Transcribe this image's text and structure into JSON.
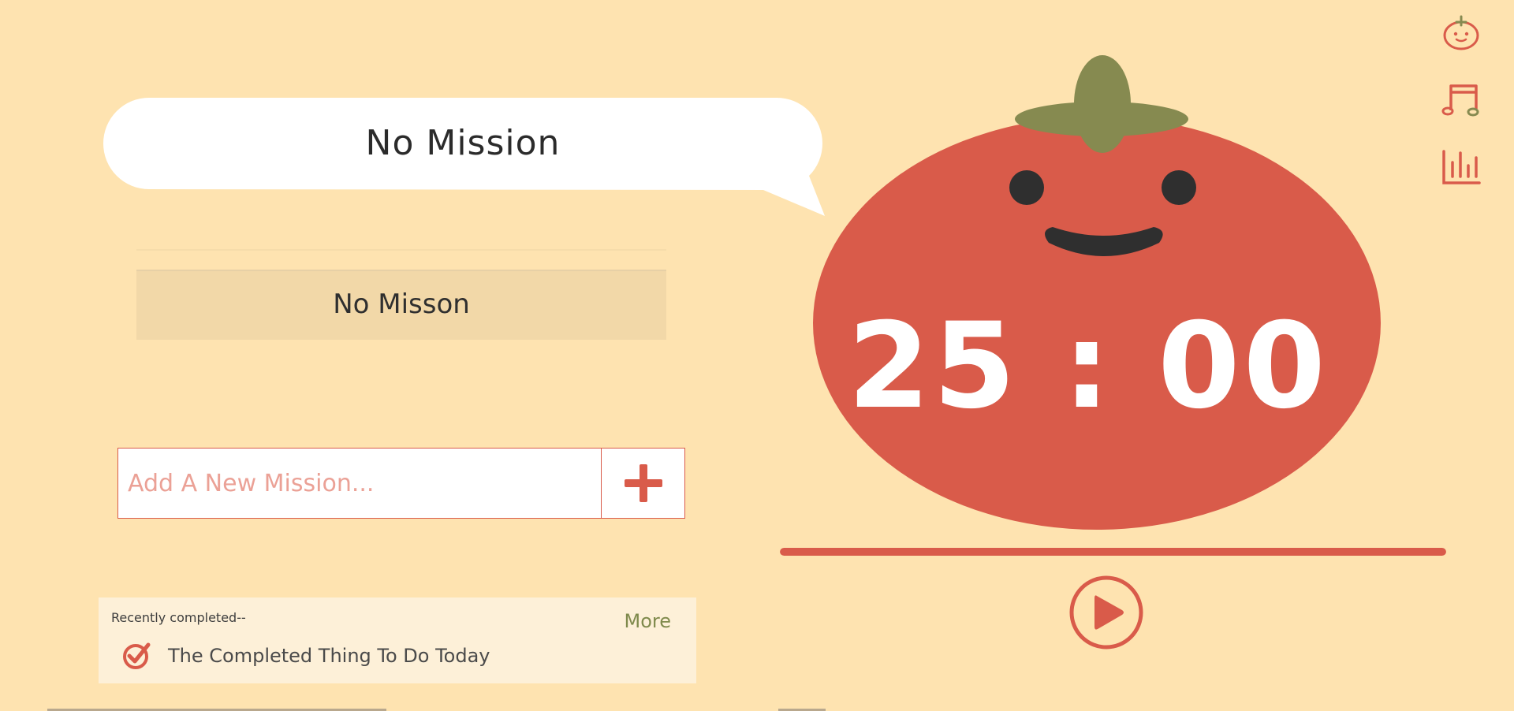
{
  "bubble": {
    "current_mission": "No Mission"
  },
  "mission_list": {
    "items": [
      {
        "label": "No Misson"
      }
    ]
  },
  "add_mission": {
    "placeholder": "Add A New Mission..."
  },
  "recent": {
    "title": "Recently completed--",
    "more_label": "More",
    "items": [
      {
        "label": "The Completed Thing To Do Today"
      }
    ]
  },
  "timer": {
    "display": "25 : 00",
    "progress": 1.0
  },
  "icons": {
    "mascot": "tomato-icon",
    "music": "music-note-icon",
    "stats": "bar-chart-icon",
    "play": "play-icon",
    "add": "plus-icon",
    "check": "check-circle-icon"
  },
  "colors": {
    "background": "#fee3b0",
    "tomato_red": "#d95b4a",
    "stem_green": "#868a50",
    "face_dark": "#2f2f2f",
    "panel": "#fdf0d8",
    "more_green": "#7f8a4c"
  }
}
